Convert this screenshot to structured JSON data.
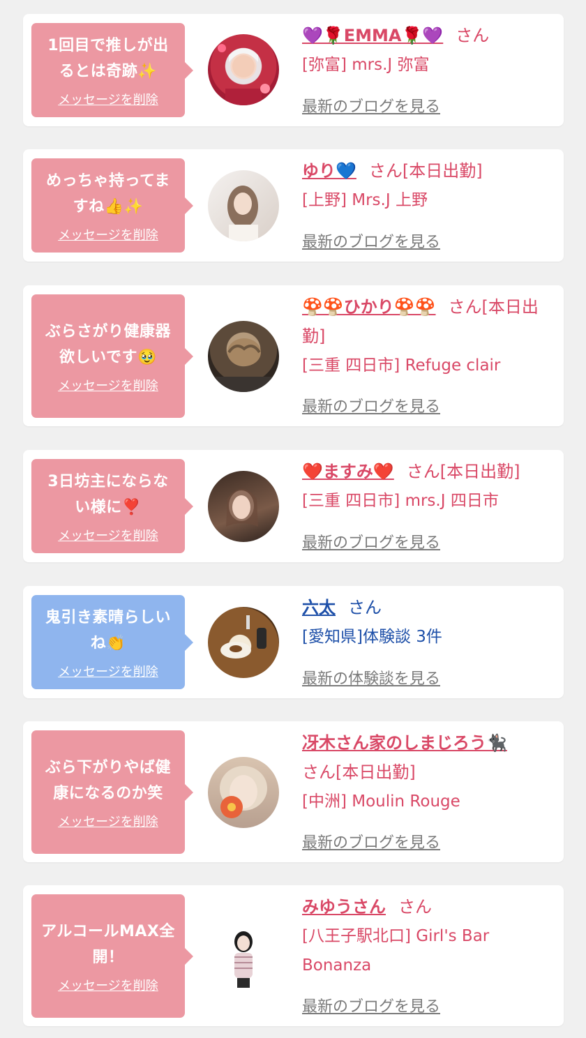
{
  "cards": [
    {
      "message": [
        "1回目で推しが出",
        "るとは奇跡✨"
      ],
      "delete_label": "メッセージを削除",
      "name": "💜🌹EMMA🌹💜",
      "honorific": "さん",
      "status": "",
      "shop": "[弥富] mrs.J 弥富",
      "more_label": "最新のブログを見る"
    },
    {
      "message": [
        "めっちゃ持ってま",
        "すね👍✨"
      ],
      "delete_label": "メッセージを削除",
      "name": "ゆり💙",
      "honorific": "さん",
      "status": "[本日出勤]",
      "shop": "[上野] Mrs.J 上野",
      "more_label": "最新のブログを見る"
    },
    {
      "message": [
        "ぶらさがり健康器",
        "欲しいです🥹"
      ],
      "delete_label": "メッセージを削除",
      "name": "🍄🍄ひかり🍄🍄",
      "honorific": "さん",
      "status": "[本日出勤]",
      "shop": "[三重 四日市] Refuge clair",
      "more_label": "最新のブログを見る"
    },
    {
      "message": [
        "3日坊主にならな",
        "い様に❣️"
      ],
      "delete_label": "メッセージを削除",
      "name": "❤️ますみ❤️",
      "honorific": "さん",
      "status": "[本日出勤]",
      "shop": "[三重 四日市] mrs.J 四日市",
      "more_label": "最新のブログを見る"
    },
    {
      "message": [
        "鬼引き素晴らしい",
        "ね👏"
      ],
      "delete_label": "メッセージを削除",
      "name": "六太",
      "honorific": "さん",
      "status": "",
      "shop": "[愛知県]体験談 3件",
      "more_label": "最新の体験談を見る"
    },
    {
      "message": [
        "ぶら下がりやば健",
        "康になるのか笑"
      ],
      "delete_label": "メッセージを削除",
      "name": "冴木さん家のしまじろう🐈‍⬛",
      "honorific": "さん",
      "status": "[本日出勤]",
      "shop": "[中洲] Moulin Rouge",
      "more_label": "最新のブログを見る"
    },
    {
      "message": [
        "アルコールMAX全",
        "開！"
      ],
      "delete_label": "メッセージを削除",
      "name": "みゆうさん",
      "honorific": "さん",
      "status": "",
      "shop": "[八王子駅北口] Girl's Bar Bonanza",
      "more_label": "最新のブログを見る"
    }
  ],
  "colors": {
    "pink_bubble": "#ec98a2",
    "blue_bubble": "#8fb5ee",
    "pink_text": "#d94866",
    "blue_text": "#1d4fa8",
    "link_gray": "#7a7a7a"
  }
}
